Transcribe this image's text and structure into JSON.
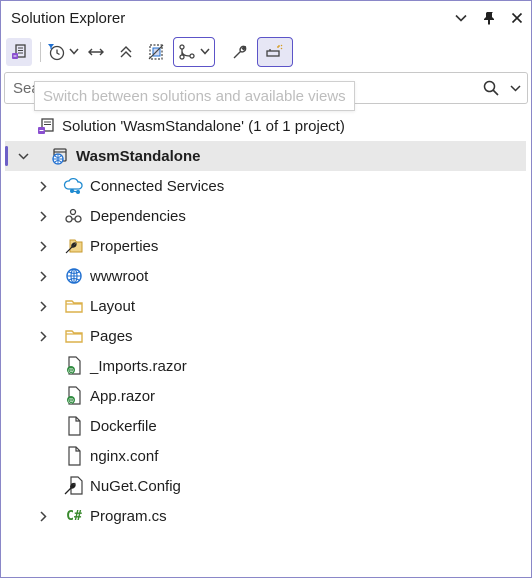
{
  "panel": {
    "title": "Solution Explorer",
    "controls": {
      "dropdown": "⌄",
      "pin": "📌",
      "close": "✕"
    }
  },
  "toolbar": {
    "buttons": [
      "switch-views",
      "pending-changes-filter",
      "sync-with-active-document",
      "collapse-all",
      "show-all-files",
      "git-filter",
      "properties",
      "preview-selected-items"
    ]
  },
  "search": {
    "placeholder": "Search Solution Explorer (Ctrl+;)"
  },
  "tooltip": {
    "text": "Switch between solutions and available views"
  },
  "tree": {
    "solution": "Solution 'WasmStandalone' (1 of 1 project)",
    "project": "WasmStandalone",
    "items": [
      {
        "label": "Connected Services",
        "icon": "connected-services-icon",
        "expandable": true
      },
      {
        "label": "Dependencies",
        "icon": "dependencies-icon",
        "expandable": true
      },
      {
        "label": "Properties",
        "icon": "properties-icon",
        "expandable": true
      },
      {
        "label": "wwwroot",
        "icon": "globe-icon",
        "expandable": true
      },
      {
        "label": "Layout",
        "icon": "folder-icon",
        "expandable": true
      },
      {
        "label": "Pages",
        "icon": "folder-icon",
        "expandable": true
      },
      {
        "label": "_Imports.razor",
        "icon": "razor-file-icon",
        "expandable": false
      },
      {
        "label": "App.razor",
        "icon": "razor-file-icon",
        "expandable": false
      },
      {
        "label": "Dockerfile",
        "icon": "file-icon",
        "expandable": false
      },
      {
        "label": "nginx.conf",
        "icon": "file-icon",
        "expandable": false
      },
      {
        "label": "NuGet.Config",
        "icon": "nuget-config-icon",
        "expandable": false
      },
      {
        "label": "Program.cs",
        "icon": "csharp-file-icon",
        "expandable": true,
        "glyph": "C#"
      }
    ]
  },
  "colors": {
    "accent": "#6c5fc7",
    "border": "#8a87c8",
    "selection": "#e8e8e8",
    "folder": "#dcb04a",
    "globe": "#1f6fd0"
  }
}
